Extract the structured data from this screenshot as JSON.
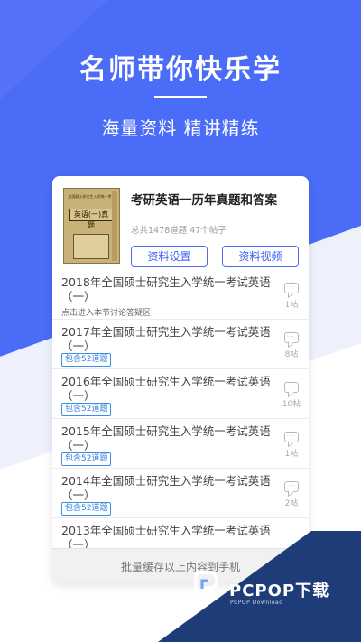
{
  "hero": {
    "title": "名师带你快乐学",
    "subtitle": "海量资料  精讲精练"
  },
  "book": {
    "cover_top": "全国硕士研究生入学统一考试",
    "cover_title": "英语(一)真题"
  },
  "card": {
    "title": "考研英语一历年真题和答案",
    "meta": "总共1478道题    47个帖子",
    "btn_settings": "资料设置",
    "btn_video": "资料视频"
  },
  "list": [
    {
      "title": "2018年全国硕士研究生入学统一考试英语（一）",
      "hint": "点击进入本节讨论答疑区",
      "posts": "1帖"
    },
    {
      "title": "2017年全国硕士研究生入学统一考试英语（一）",
      "badge": "包含52道题",
      "posts": "8帖"
    },
    {
      "title": "2016年全国硕士研究生入学统一考试英语（一）",
      "badge": "包含52道题",
      "posts": "10帖"
    },
    {
      "title": "2015年全国硕士研究生入学统一考试英语（一）",
      "badge": "包含52道题",
      "posts": "1帖"
    },
    {
      "title": "2014年全国硕士研究生入学统一考试英语（一）",
      "badge": "包含52道题",
      "posts": "2帖"
    },
    {
      "title": "2013年全国硕士研究生入学统一考试英语（一）"
    }
  ],
  "bottom": {
    "label": "批量缓存以上内容到手机"
  },
  "watermark": {
    "brand": "PCPOP下载",
    "sub": "PCPOP Download"
  },
  "colors": {
    "hero_blue": "#4b6cf7",
    "accent": "#3b5ff2",
    "badge": "#2e82e0",
    "watermark": "#1e3c78"
  }
}
